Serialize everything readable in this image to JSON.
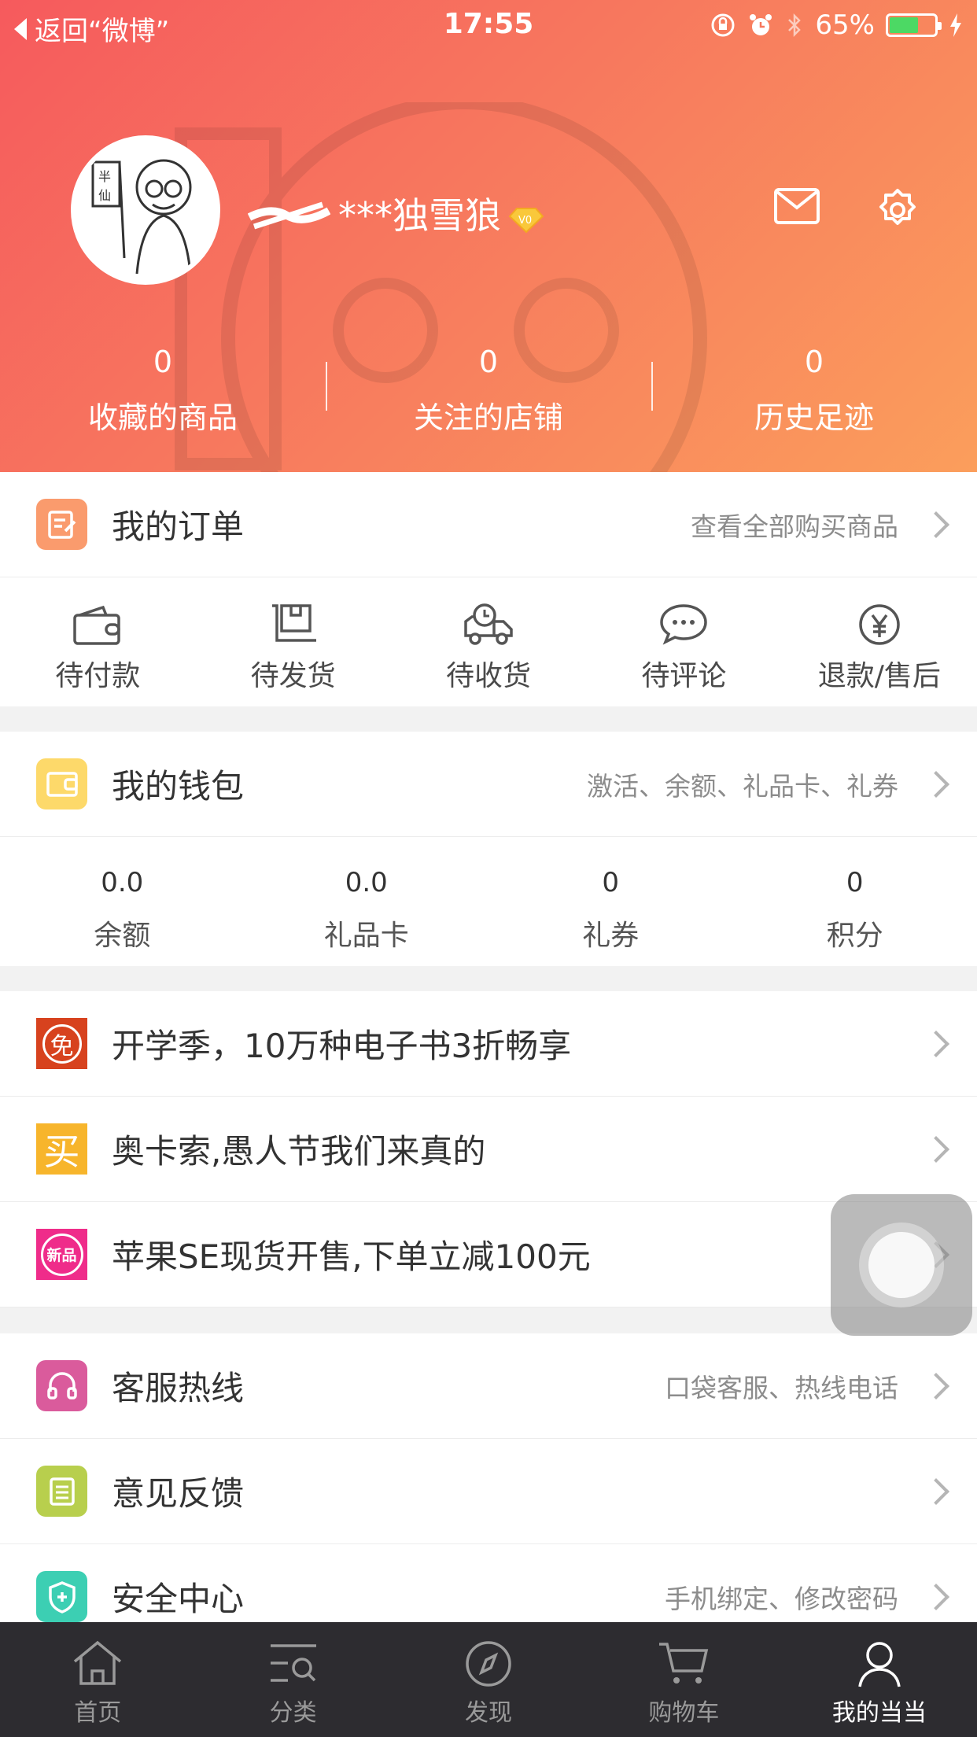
{
  "status_bar": {
    "back_label": "返回“微博”",
    "time": "17:55",
    "battery": "65%",
    "battery_level": 0.65
  },
  "profile": {
    "username_suffix": "***独雪狼",
    "level_badge": "V0"
  },
  "stats": [
    {
      "value": "0",
      "label": "收藏的商品"
    },
    {
      "value": "0",
      "label": "关注的店铺"
    },
    {
      "value": "0",
      "label": "历史足迹"
    }
  ],
  "orders": {
    "title": "我的订单",
    "link": "查看全部购买商品",
    "items": [
      {
        "label": "待付款",
        "icon": "wallet-icon"
      },
      {
        "label": "待发货",
        "icon": "package-cart-icon"
      },
      {
        "label": "待收货",
        "icon": "truck-clock-icon"
      },
      {
        "label": "待评论",
        "icon": "chat-bubble-icon"
      },
      {
        "label": "退款/售后",
        "icon": "yen-circle-icon"
      }
    ]
  },
  "wallet": {
    "title": "我的钱包",
    "link": "激活、余额、礼品卡、礼券",
    "items": [
      {
        "value": "0.0",
        "label": "余额"
      },
      {
        "value": "0.0",
        "label": "礼品卡"
      },
      {
        "value": "0",
        "label": "礼券"
      },
      {
        "value": "0",
        "label": "积分"
      }
    ]
  },
  "promos": [
    {
      "icon_text": "免",
      "title": "开学季，10万种电子书3折畅享",
      "color": "#d7421e"
    },
    {
      "icon_text": "买",
      "title": "奥卡索,愚人节我们来真的",
      "color": "#f7b52c"
    },
    {
      "icon_text": "新品",
      "title": "苹果SE现货开售,下单立减100元",
      "color": "#ef2c8a"
    }
  ],
  "services": [
    {
      "title": "客服热线",
      "sub": "口袋客服、热线电话",
      "icon": "headset-icon",
      "color": "#da5b9c"
    },
    {
      "title": "意见反馈",
      "sub": "",
      "icon": "document-icon",
      "color": "#b8cf4d"
    },
    {
      "title": "安全中心",
      "sub": "手机绑定、修改密码",
      "icon": "shield-icon",
      "color": "#3ccfb3"
    }
  ],
  "tabs": [
    {
      "label": "首页",
      "icon": "home-icon"
    },
    {
      "label": "分类",
      "icon": "category-search-icon"
    },
    {
      "label": "发现",
      "icon": "compass-icon"
    },
    {
      "label": "购物车",
      "icon": "cart-icon"
    },
    {
      "label": "我的当当",
      "icon": "person-icon",
      "active": true
    }
  ],
  "colors": {
    "header_start": "#f65a5d",
    "header_end": "#fb9e5c",
    "tabbar": "#2d2c30"
  }
}
